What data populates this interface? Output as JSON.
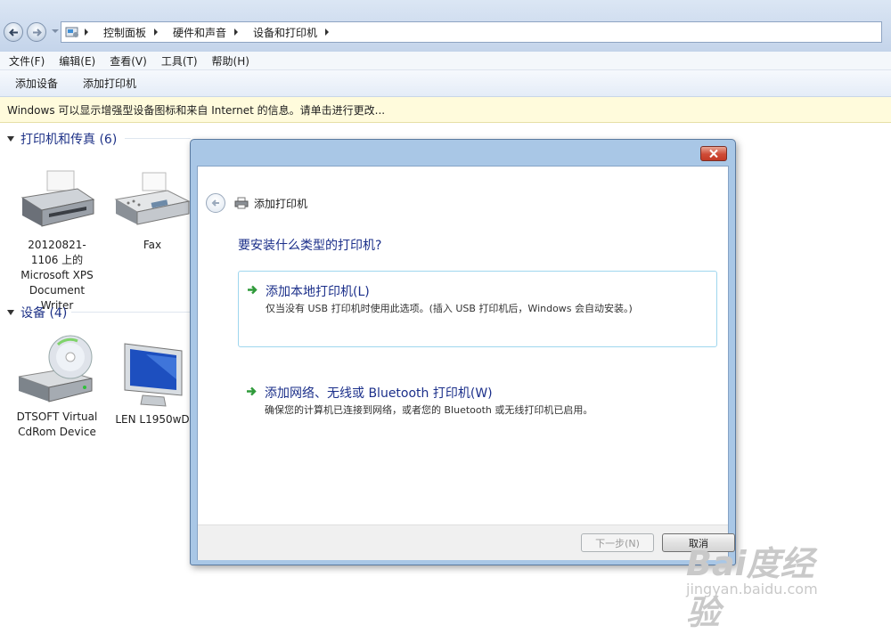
{
  "breadcrumb": [
    "控制面板",
    "硬件和声音",
    "设备和打印机"
  ],
  "menu": [
    "文件(F)",
    "编辑(E)",
    "查看(V)",
    "工具(T)",
    "帮助(H)"
  ],
  "toolbar": {
    "add_device": "添加设备",
    "add_printer": "添加打印机"
  },
  "infobar": "Windows 可以显示增强型设备图标和来自 Internet 的信息。请单击进行更改...",
  "groups": {
    "printers": {
      "title": "打印机和传真 (6)",
      "items": [
        {
          "label": "20120821-1106 上的 Microsoft XPS Document Writer",
          "icon": "printer-icon"
        },
        {
          "label": "Fax",
          "icon": "fax-icon"
        }
      ]
    },
    "devices": {
      "title": "设备 (4)",
      "items": [
        {
          "label": "DTSOFT Virtual CdRom Device",
          "icon": "cdrom-drive-icon"
        },
        {
          "label": "LEN L1950wD",
          "icon": "monitor-icon"
        }
      ]
    }
  },
  "dialog": {
    "title": "添加打印机",
    "question": "要安装什么类型的打印机?",
    "options": [
      {
        "title": "添加本地打印机(L)",
        "desc": "仅当没有 USB 打印机时使用此选项。(插入 USB 打印机后，Windows 会自动安装。)"
      },
      {
        "title": "添加网络、无线或 Bluetooth 打印机(W)",
        "desc": "确保您的计算机已连接到网络，或者您的 Bluetooth 或无线打印机已启用。"
      }
    ],
    "next": "下一步(N)",
    "cancel": "取消"
  },
  "watermark": {
    "line1": "Bai度经验",
    "line2": "jingyan.baidu.com"
  },
  "colors": {
    "accent": "#1b2f8a",
    "info_bar": "#fffbdc",
    "close_button": "#c33a26"
  }
}
